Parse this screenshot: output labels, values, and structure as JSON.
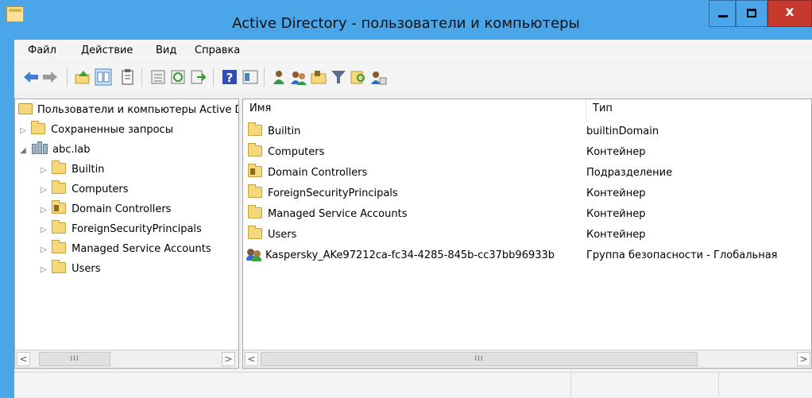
{
  "window": {
    "title": "Active Directory - пользователи и компьютеры",
    "close_label": "x"
  },
  "menu": {
    "items": [
      "Файл",
      "Действие",
      "Вид",
      "Справка"
    ]
  },
  "toolbar": {
    "buttons": [
      "back-arrow-icon",
      "forward-arrow-icon",
      "up-folder-icon",
      "show-tree-icon",
      "properties-icon",
      "list-icon",
      "refresh-icon",
      "export-icon",
      "help-icon",
      "details-view-icon",
      "new-user-icon",
      "new-group-icon",
      "new-ou-icon",
      "filter-icon",
      "find-icon",
      "add-to-group-icon"
    ]
  },
  "tree": {
    "root": "Пользователи и компьютеры Active Directory",
    "saved_queries": "Сохраненные запросы",
    "domain": "abc.lab",
    "children": [
      "Builtin",
      "Computers",
      "Domain Controllers",
      "ForeignSecurityPrincipals",
      "Managed Service Accounts",
      "Users"
    ]
  },
  "list": {
    "headers": {
      "name": "Имя",
      "type": "Тип"
    },
    "rows": [
      {
        "name": "Builtin",
        "type": "builtinDomain",
        "icon": "folder"
      },
      {
        "name": "Computers",
        "type": "Контейнер",
        "icon": "folder"
      },
      {
        "name": "Domain Controllers",
        "type": "Подразделение",
        "icon": "ou-folder"
      },
      {
        "name": "ForeignSecurityPrincipals",
        "type": "Контейнер",
        "icon": "folder"
      },
      {
        "name": "Managed Service Accounts",
        "type": "Контейнер",
        "icon": "folder"
      },
      {
        "name": "Users",
        "type": "Контейнер",
        "icon": "folder"
      },
      {
        "name": "Kaspersky_AKe97212ca-fc34-4285-845b-cc37bb96933b",
        "type": "Группа безопасности - Глобальная",
        "icon": "group"
      }
    ]
  },
  "scroll": {
    "left": "<",
    "right": ">",
    "thumb": "III"
  },
  "colors": {
    "titlebar": "#4aa6e8",
    "close": "#c7382d",
    "folder": "#f6d77a"
  }
}
